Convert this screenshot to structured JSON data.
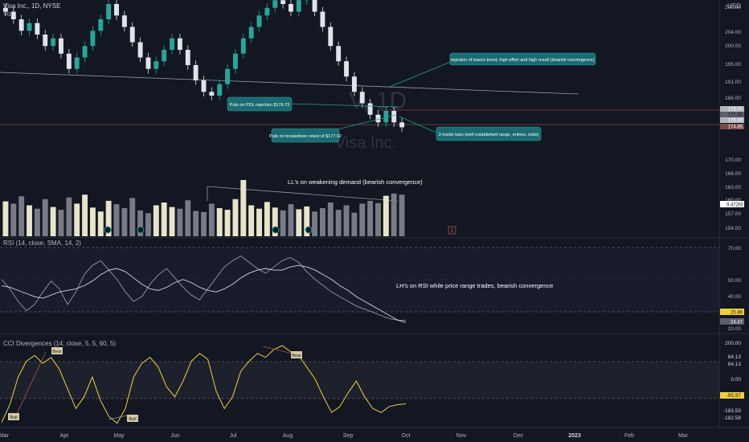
{
  "header": {
    "symbol_line": "Visa Inc., 1D, NYSE",
    "vol_label": "Vol",
    "currency": "USD"
  },
  "watermark": {
    "ticker": "V, 1D",
    "name": "Visa Inc."
  },
  "price_pane": {
    "axis_ticks": [
      "208.00",
      "204.00",
      "200.00",
      "195.00",
      "191.00",
      "186.00",
      "182.00",
      "178.74",
      "177.65",
      "176.95",
      "174.85",
      "170.00",
      "166.00",
      "163.00",
      "160.00",
      "157.00",
      "154.00",
      "151.00"
    ],
    "labels": [
      {
        "value": "178.74",
        "color": "#b2b5be"
      },
      {
        "value": "177.65",
        "color": "#5d606b"
      },
      {
        "value": "176.95",
        "color": "#b2b5be"
      },
      {
        "value": "174.85",
        "color": "#7a4a48"
      }
    ],
    "volume_label": "9.472M"
  },
  "annotations": {
    "rejection_macro": "rejection of macro trend, high effort and high result (bearish convergence)",
    "puts_pdl": "Puts on PDL rejection $178.73",
    "puts_breakdown": "Puts on breakdown retest of $177.02",
    "inside_bars": "3 inside bars (well established range, entries, exits)",
    "ll_demand": "LL's on weakening demand (bearish convergence)",
    "rsi_note": "LH's on RSI while price range trades, bearish convergence"
  },
  "rsi_pane": {
    "title": "RSI (14, close, SMA, 14, 2)",
    "axis_ticks": [
      "70.00",
      "50.00",
      "40.00",
      "30.00",
      "20.00"
    ],
    "value_labels": [
      {
        "value": "25.86",
        "color": "#f0ce3c"
      },
      {
        "value": "24.47",
        "color": "#5d606b"
      }
    ]
  },
  "cci_pane": {
    "title": "CCI Divergences (14, close, 5, 5, 60, 5)",
    "axis_ticks": [
      "200.00",
      "84.13",
      "84.13",
      "0.00",
      "-95.97",
      "-183.58",
      "-182.58"
    ],
    "divergence_tags": [
      "Bull",
      "Bear",
      "Bull",
      "Bear"
    ]
  },
  "time_axis": [
    "Mar",
    "Apr",
    "May",
    "Jun",
    "Jul",
    "Aug",
    "Sep",
    "Oct",
    "Nov",
    "Dec",
    "2023",
    "Feb",
    "Mar"
  ],
  "chart_data": [
    {
      "type": "candlestick",
      "title": "Visa Inc., 1D, NYSE",
      "y_unit": "USD",
      "ylim": [
        150,
        210
      ],
      "x_range": [
        "Mar 2022",
        "Mar 2023"
      ],
      "key_levels": [
        178.74,
        177.65,
        176.95,
        174.85
      ],
      "closes": [
        208,
        206,
        203,
        205,
        202,
        199,
        201,
        197,
        193,
        196,
        199,
        203,
        206,
        210,
        207,
        204,
        200,
        196,
        193,
        195,
        198,
        201,
        198,
        194,
        190,
        187,
        186,
        189,
        193,
        197,
        201,
        204,
        207,
        209,
        211,
        210,
        208,
        211,
        212,
        208,
        204,
        199,
        195,
        191,
        187,
        184,
        181,
        179,
        182,
        179,
        177.7
      ]
    },
    {
      "type": "bar",
      "title": "Vol",
      "last_value": "9.472M",
      "values": [
        0.62,
        0.58,
        0.71,
        0.55,
        0.49,
        0.66,
        0.52,
        0.47,
        0.69,
        0.58,
        0.74,
        0.51,
        0.44,
        0.63,
        0.57,
        0.5,
        0.68,
        0.46,
        0.41,
        0.55,
        0.6,
        0.52,
        0.49,
        0.64,
        0.45,
        0.43,
        0.58,
        0.5,
        0.47,
        0.66,
        1.0,
        0.55,
        0.49,
        0.61,
        0.51,
        0.46,
        0.57,
        0.48,
        0.53,
        0.44,
        0.5,
        0.6,
        0.47,
        0.55,
        0.42,
        0.58,
        0.63,
        0.59,
        0.72,
        0.76,
        0.74
      ]
    },
    {
      "type": "line",
      "title": "RSI (14, close, SMA, 14, 2)",
      "ylim": [
        20,
        75
      ],
      "bands": [
        30,
        70
      ],
      "series": [
        {
          "name": "RSI",
          "last": 25.86,
          "values": [
            52,
            46,
            38,
            32,
            36,
            44,
            51,
            46,
            36,
            44,
            55,
            61,
            64,
            58,
            52,
            44,
            38,
            41,
            49,
            55,
            59,
            53,
            47,
            42,
            39,
            46,
            53,
            60,
            64,
            67,
            63,
            59,
            56,
            60,
            64,
            66,
            63,
            57,
            52,
            48,
            44,
            41,
            38,
            35,
            33,
            31,
            29,
            27,
            26,
            25.86
          ]
        },
        {
          "name": "RSI-based MA",
          "last": 24.47,
          "values": [
            48,
            47,
            45,
            43,
            41,
            40,
            42,
            44,
            45,
            46,
            48,
            51,
            55,
            58,
            59,
            57,
            53,
            49,
            46,
            45,
            47,
            50,
            52,
            50,
            47,
            45,
            44,
            46,
            49,
            53,
            56,
            58,
            59,
            58,
            58,
            60,
            61,
            60,
            58,
            55,
            52,
            48,
            45,
            41,
            38,
            35,
            32,
            29,
            26,
            24.47
          ]
        }
      ]
    },
    {
      "type": "line",
      "title": "CCI Divergences (14, close, 5, 5, 60, 5)",
      "ylim": [
        -200,
        200
      ],
      "bands": [
        -100,
        100
      ],
      "series": [
        {
          "name": "CCI",
          "last": -95.97,
          "values": [
            -190,
            -100,
            40,
            120,
            150,
            110,
            140,
            80,
            -20,
            -120,
            -60,
            40,
            -80,
            -160,
            -195,
            -120,
            40,
            110,
            140,
            90,
            -10,
            -60,
            20,
            120,
            160,
            130,
            -30,
            -120,
            -60,
            70,
            120,
            160,
            140,
            180,
            200,
            170,
            150,
            90,
            30,
            -60,
            -140,
            -110,
            -40,
            20,
            -60,
            -120,
            -140,
            -110,
            -100,
            -95.97
          ]
        }
      ]
    }
  ]
}
